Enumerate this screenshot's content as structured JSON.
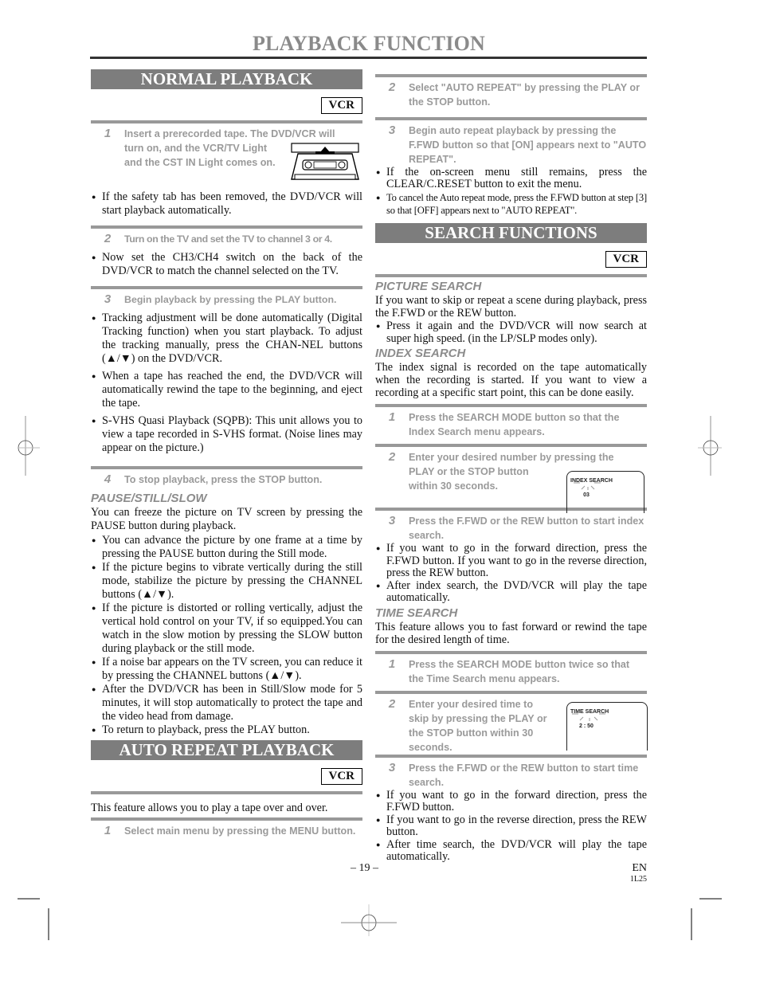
{
  "page": {
    "title": "PLAYBACK FUNCTION",
    "page_number": "– 19 –",
    "language": "EN",
    "code": "1L25"
  },
  "normal_playback": {
    "heading": "NORMAL PLAYBACK",
    "badge": "VCR",
    "steps": [
      {
        "num": "1",
        "text": "Insert a prerecorded tape. The DVD/VCR will turn on, and the VCR/TV Light and the CST IN Light comes on.",
        "text_line1": "Insert a prerecorded tape. The DVD/VCR will",
        "text_rest": "turn on, and the VCR/TV Light and the CST IN Light comes on.",
        "bullets": [
          "If the safety tab has been removed, the DVD/VCR will start playback automatically."
        ]
      },
      {
        "num": "2",
        "text": "Turn on the TV and set the TV to channel 3 or 4.",
        "bullets": [
          "Now set the CH3/CH4 switch on the back of the DVD/VCR to match the channel selected on the TV."
        ]
      },
      {
        "num": "3",
        "text": "Begin playback by pressing the PLAY button.",
        "bullets": [
          "Tracking adjustment will be done automatically (Digital Tracking function) when you start playback. To adjust the tracking manually, press the CHAN-NEL buttons (▲/▼) on the DVD/VCR.",
          "When a tape has reached the end, the DVD/VCR will automatically rewind the tape to the beginning, and eject the tape.",
          "S-VHS Quasi Playback (SQPB): This unit allows you to view a tape recorded in S-VHS format. (Noise lines may appear on the picture.)"
        ]
      },
      {
        "num": "4",
        "text": "To stop playback, press the STOP button."
      }
    ],
    "pause": {
      "heading": "PAUSE/STILL/SLOW",
      "intro": "You can freeze the picture on TV screen by pressing the PAUSE button during playback.",
      "bullets": [
        "You can advance the picture by one frame at a time by pressing the PAUSE button during the Still mode.",
        "If the picture begins to vibrate vertically during the still mode, stabilize the picture by pressing the CHANNEL buttons (▲/▼).",
        "If the picture is distorted or rolling vertically, adjust the vertical hold control on your TV, if so equipped.You can watch in the slow motion by pressing the SLOW button during playback or the still mode.",
        "If a noise bar appears on the TV screen, you can reduce it by pressing the CHANNEL buttons (▲/▼).",
        "After the DVD/VCR has been in Still/Slow mode for 5 minutes, it will stop automatically to protect the tape and the video head from damage.",
        "To return to playback, press the PLAY button."
      ]
    }
  },
  "auto_repeat": {
    "heading": "AUTO REPEAT PLAYBACK",
    "badge": "VCR",
    "intro": "This feature allows you to play a tape over and over.",
    "steps": [
      {
        "num": "1",
        "text": "Select main menu by pressing the MENU button."
      },
      {
        "num": "2",
        "text": "Select \"AUTO REPEAT\" by pressing the PLAY or the STOP button."
      },
      {
        "num": "3",
        "text": "Begin auto repeat playback by pressing the F.FWD button so that [ON] appears next to \"AUTO REPEAT\"."
      }
    ],
    "bullets": [
      "If the on-screen menu still remains, press the CLEAR/C.RESET button to exit the menu.",
      "To cancel the Auto repeat mode, press the F.FWD button at step [3] so that [OFF] appears next to \"AUTO REPEAT\"."
    ]
  },
  "search": {
    "heading": "SEARCH FUNCTIONS",
    "badge": "VCR",
    "picture": {
      "heading": "PICTURE SEARCH",
      "intro": "If you want to skip or repeat a scene during playback, press the F.FWD or the REW button.",
      "bullets": [
        "Press it again and the DVD/VCR will now search at super high speed. (in the LP/SLP modes only)."
      ]
    },
    "index": {
      "heading": "INDEX SEARCH",
      "intro": "The index signal is recorded on the tape automatically when the recording is started. If you want to view a recording at a specific start point, this can be done easily.",
      "steps": [
        {
          "num": "1",
          "text": "Press the SEARCH MODE button  so that the Index Search menu appears."
        },
        {
          "num": "2",
          "text": "Enter your desired number by pressing the",
          "text_rest": "PLAY or the STOP button within 30 seconds."
        },
        {
          "num": "3",
          "text": "Press the F.FWD or the REW button to start index search."
        }
      ],
      "osd": {
        "label": "INDEX SEARCH",
        "value": "03"
      },
      "bullets": [
        "If you want to go in the forward direction, press the F.FWD button. If you want to go in the reverse direction, press the REW button.",
        "After index search, the DVD/VCR will play the tape automatically."
      ]
    },
    "time": {
      "heading": "TIME SEARCH",
      "intro": "This feature allows you to fast forward or rewind the tape for the desired length of time.",
      "steps": [
        {
          "num": "1",
          "text": "Press  the SEARCH MODE button twice so that the Time Search menu appears."
        },
        {
          "num": "2",
          "text": "Enter your desired time to skip by pressing the PLAY or the STOP button within 30 seconds."
        },
        {
          "num": "3",
          "text": "Press the F.FWD or the REW button to start time search."
        }
      ],
      "osd": {
        "label": "TIME SEARCH",
        "value": "2 : 50"
      },
      "bullets": [
        "If you want to go in the forward direction, press the F.FWD button.",
        "If you want to go in the reverse direction, press the REW button.",
        "After time search, the DVD/VCR will play the tape automatically."
      ]
    }
  }
}
